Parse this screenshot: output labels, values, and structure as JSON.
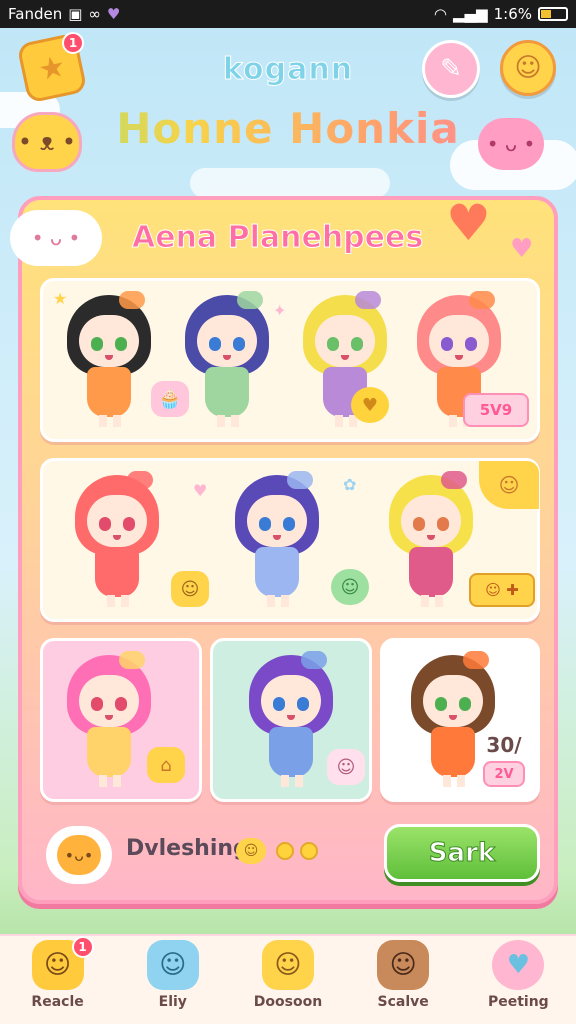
{
  "status_bar": {
    "carrier": "Fanden",
    "time": "1:6%",
    "icons": [
      "camera-icon",
      "link-icon",
      "heart-icon",
      "wifi-icon",
      "signal-icon",
      "battery-icon"
    ]
  },
  "header": {
    "star_badge": "1",
    "subtitle": "kogann",
    "title": "Honne Honkia"
  },
  "panel": {
    "title": "Aena Planehpees",
    "row1_price": "5V9",
    "row3_price": "30/",
    "row3_price_sub": "2V",
    "blessing_label": "Dvleshing",
    "start_button": "Sark"
  },
  "characters": [
    {
      "hair": "#2b2b2b",
      "eye": "#4caf50",
      "dress": "#ff9a4a"
    },
    {
      "hair": "#4b4ba8",
      "eye": "#3a7bd5",
      "dress": "#9fd6a0"
    },
    {
      "hair": "#f5de4c",
      "eye": "#6abf69",
      "dress": "#b98ad8"
    },
    {
      "hair": "#ff8a8a",
      "eye": "#8a5bd0",
      "dress": "#ff8a4a"
    },
    {
      "hair": "#ff6a6a",
      "eye": "#e24b6b",
      "dress": "#ff6a6a"
    },
    {
      "hair": "#5a4ab8",
      "eye": "#3a7bd5",
      "dress": "#9bb6f0"
    },
    {
      "hair": "#f7e14a",
      "eye": "#e27a4b",
      "dress": "#e05a8a"
    },
    {
      "hair": "#ff6fb5",
      "eye": "#e24b6b",
      "dress": "#ffd36a"
    },
    {
      "hair": "#7a4ac8",
      "eye": "#3a7bd5",
      "dress": "#7aa0e8"
    },
    {
      "hair": "#7a4a2a",
      "eye": "#4caf50",
      "dress": "#ff7a3a"
    }
  ],
  "nav": [
    {
      "label": "Reacle",
      "icon": "fox-icon",
      "badge": "1"
    },
    {
      "label": "Eliy",
      "icon": "cloud-pet-icon"
    },
    {
      "label": "Doosoon",
      "icon": "cat-icon"
    },
    {
      "label": "Scalve",
      "icon": "bear-icon"
    },
    {
      "label": "Peeting",
      "icon": "heart-icon"
    }
  ]
}
